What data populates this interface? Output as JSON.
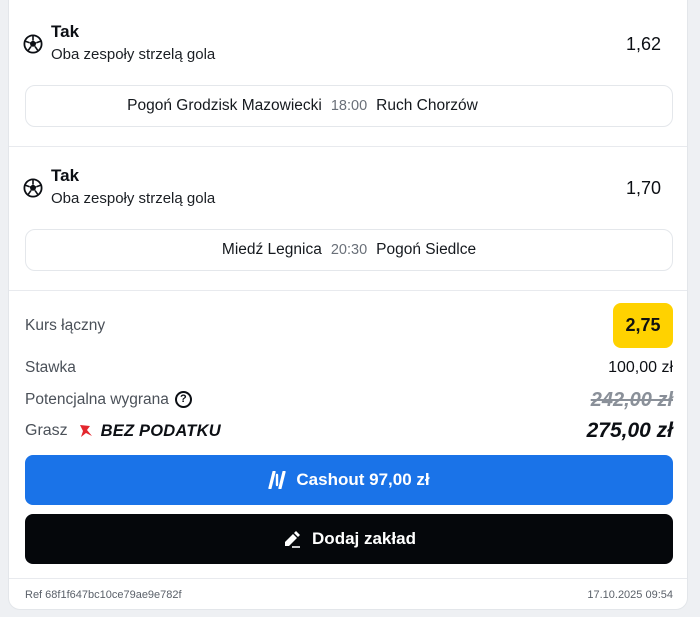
{
  "selections": [
    {
      "pick": "Tak",
      "market": "Oba zespoły strzelą gola",
      "odd": "1,62",
      "home": "Pogoń Grodzisk Mazowiecki",
      "time": "18:00",
      "away": "Ruch Chorzów"
    },
    {
      "pick": "Tak",
      "market": "Oba zespoły strzelą gola",
      "odd": "1,70",
      "home": "Miedź Legnica",
      "time": "20:30",
      "away": "Pogoń Siedlce"
    }
  ],
  "summary": {
    "total_odds_label": "Kurs łączny",
    "total_odds": "2,75",
    "stake_label": "Stawka",
    "stake": "100,00 zł",
    "potential_win_label": "Potencjalna wygrana",
    "help_glyph": "?",
    "potential_win_old": "242,00 zł",
    "play_label": "Grasz",
    "tax_free_label": "BEZ PODATKU",
    "potential_win_new": "275,00 zł"
  },
  "buttons": {
    "cashout_label": "Cashout 97,00 zł",
    "add_bet_label": "Dodaj zakład"
  },
  "footer": {
    "ref": "Ref 68f1f647bc10ce79ae9e782f",
    "datetime": "17.10.2025 09:54"
  },
  "colors": {
    "accent_blue": "#1a73e8",
    "badge_yellow": "#ffd200",
    "tax_red": "#e3262d"
  }
}
